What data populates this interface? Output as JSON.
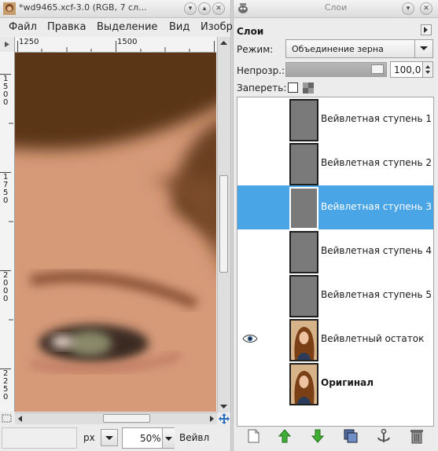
{
  "image_window": {
    "title": "*wd9465.xcf-3.0 (RGB, 7 сл...",
    "menu": [
      "Файл",
      "Правка",
      "Выделение",
      "Вид",
      "Изобр"
    ],
    "ruler_top": [
      "1250",
      "1500"
    ],
    "ruler_left": [
      "1500",
      "1750",
      "2000",
      "2250"
    ],
    "status": {
      "unit": "px",
      "zoom": "50%",
      "layer_text": "Вейвл"
    }
  },
  "layers_dock": {
    "title": "Слои",
    "tab_label": "Слои",
    "mode_label": "Режим:",
    "mode_value": "Объединение зерна",
    "opacity_label": "Непрозр.:",
    "opacity_value": "100,0",
    "opacity_percent": 100,
    "lock_label": "Запереть:",
    "layers": [
      {
        "name": "Вейвлетная ступень 1",
        "visible": false,
        "selected": false,
        "bold": false,
        "thumb": "gray"
      },
      {
        "name": "Вейвлетная ступень 2",
        "visible": false,
        "selected": false,
        "bold": false,
        "thumb": "gray"
      },
      {
        "name": "Вейвлетная ступень 3",
        "visible": false,
        "selected": true,
        "bold": false,
        "thumb": "gray"
      },
      {
        "name": "Вейвлетная ступень 4",
        "visible": false,
        "selected": false,
        "bold": false,
        "thumb": "gray"
      },
      {
        "name": "Вейвлетная ступень 5",
        "visible": false,
        "selected": false,
        "bold": false,
        "thumb": "gray"
      },
      {
        "name": "Вейвлетный остаток",
        "visible": true,
        "selected": false,
        "bold": false,
        "thumb": "portrait"
      },
      {
        "name": "Оригинал",
        "visible": false,
        "selected": false,
        "bold": true,
        "thumb": "portrait"
      }
    ]
  },
  "colors": {
    "selection": "#4aa5e6",
    "add_green": "#3fae35"
  }
}
